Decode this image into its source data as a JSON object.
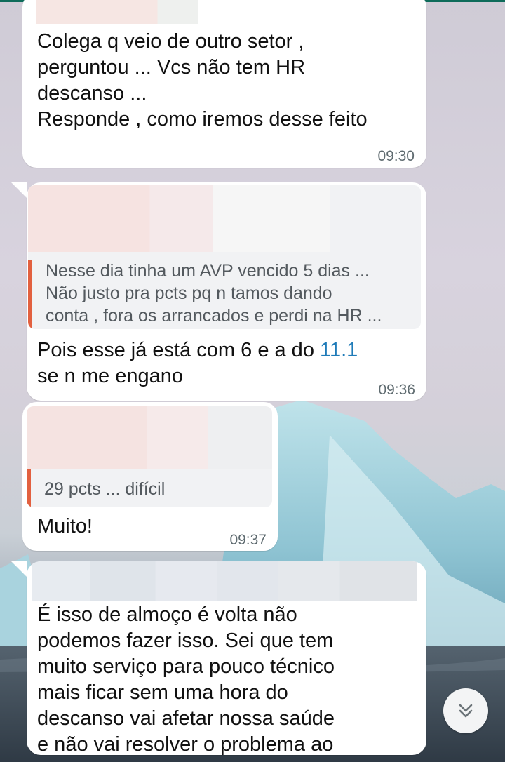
{
  "messages": [
    {
      "text": "Colega q veio de outro setor ,\nperguntou ... Vcs não tem HR\ndescanso ...\nResponde , como iremos desse feito",
      "time": "09:30"
    },
    {
      "quote": "Nesse dia tinha um AVP vencido 5 dias ...\nNão justo pra pcts pq n tamos dando\nconta , fora os arrancados e perdi na HR ...",
      "text_before_link": "Pois esse já está com 6 e a do ",
      "link": "11.1",
      "text_after_link": "se n me engano",
      "time": "09:36"
    },
    {
      "quote": "29 pcts ... difícil",
      "text": "Muito!",
      "time": "09:37"
    },
    {
      "text": "É isso de almoço é volta não\npodemos fazer isso. Sei que tem\nmuito serviço para pouco técnico\nmais ficar sem uma hora do\ndescanso vai afetar nossa saúde\ne não vai resolver o problema ao"
    }
  ],
  "colors": {
    "quote_bar": "#e2603f",
    "link": "#1f7bb8",
    "header_line": "#0e6b5a"
  },
  "icons": {
    "scroll_down": "double-chevron-down-icon"
  }
}
